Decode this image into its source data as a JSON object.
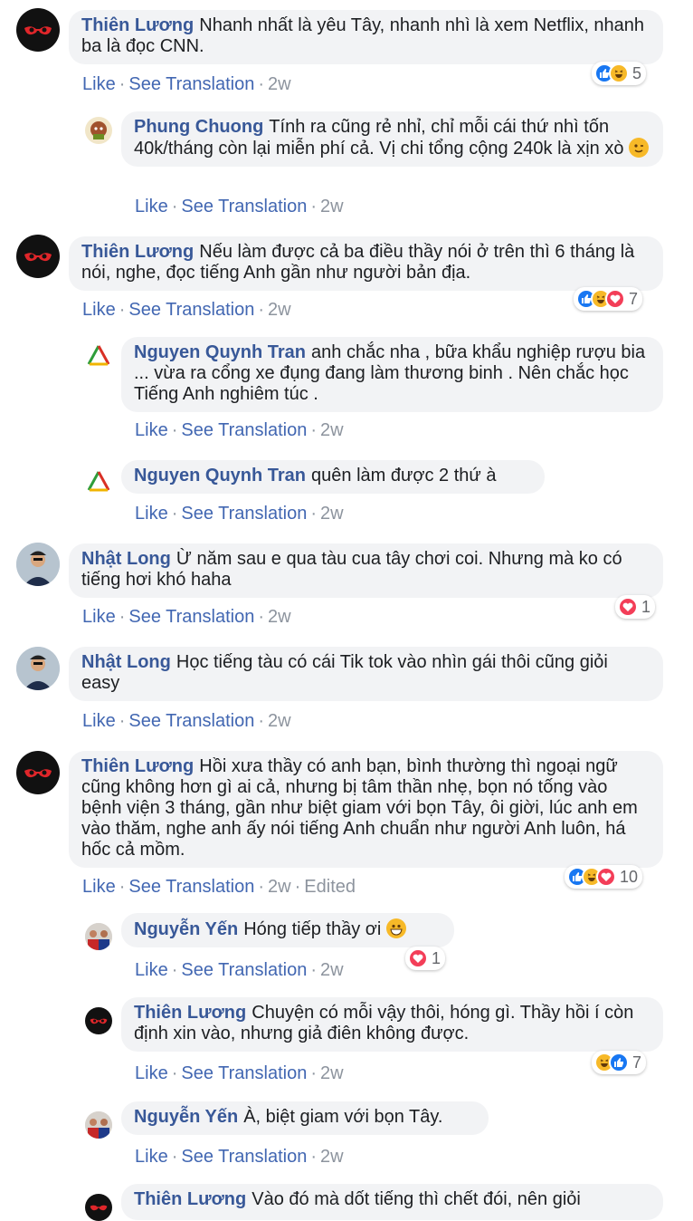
{
  "ui": {
    "like": "Like",
    "see_translation": "See Translation",
    "edited": "Edited",
    "dot": "·"
  },
  "colors": {
    "link": "#385898",
    "action": "#4267b2",
    "meta": "#8d949e",
    "bubble": "#f2f3f5",
    "like": "#1877f2",
    "haha": "#f7b928",
    "love": "#f33e58"
  },
  "comments": [
    {
      "author": "Thiên Lương",
      "text": "Nhanh nhất là yêu Tây, nhanh nhì là xem Netflix, nhanh ba là đọc CNN.",
      "time": "2w",
      "avatar": "red-glasses",
      "reactions": [
        "like",
        "haha"
      ],
      "reaction_count": "5"
    },
    {
      "author": "Phung Chuong",
      "text": "Tính ra cũng rẻ nhỉ, chỉ mỗi cái thứ nhì tốn 40k/tháng còn lại miễn phí cả. Vị chi tổng cộng 240k là xịn xò",
      "emoji": "wink",
      "time": "2w",
      "avatar": "cartoon"
    },
    {
      "author": "Thiên Lương",
      "text": "Nếu làm được cả ba điều thầy nói ở trên thì 6 tháng là nói, nghe, đọc tiếng Anh gần như người bản địa.",
      "time": "2w",
      "avatar": "red-glasses",
      "reactions": [
        "like",
        "haha",
        "love"
      ],
      "reaction_count": "7"
    },
    {
      "author": "Nguyen Quynh Tran",
      "text": "anh chắc nha , bữa khẩu nghiệp rượu bia ... vừa ra cổng xe đụng đang làm thương binh . Nên chắc học Tiếng Anh nghiêm túc .",
      "time": "2w",
      "avatar": "triangle"
    },
    {
      "author": "Nguyen Quynh Tran",
      "text": "quên làm được 2 thứ à",
      "time": "2w",
      "avatar": "triangle"
    },
    {
      "author": "Nhật Long",
      "text": "Ừ năm sau e qua tàu cua tây chơi coi. Nhưng mà ko có tiếng hơi khó haha",
      "time": "2w",
      "avatar": "person",
      "reactions": [
        "love"
      ],
      "reaction_count": "1"
    },
    {
      "author": "Nhật Long",
      "text": "Học tiếng tàu có cái Tik tok vào nhìn gái thôi cũng giỏi easy",
      "time": "2w",
      "avatar": "person"
    },
    {
      "author": "Thiên Lương",
      "text": "Hồi xưa thầy có anh bạn, bình thường thì ngoại ngữ cũng không hơn gì ai cả, nhưng bị tâm thần nhẹ, bọn nó tống vào bệnh viện 3 tháng, gần như biệt giam với bọn Tây, ôi giời, lúc anh em vào thăm, nghe anh ấy nói tiếng Anh chuẩn như người Anh luôn, há hốc cả mồm.",
      "time": "2w",
      "edited": true,
      "avatar": "red-glasses",
      "reactions": [
        "like",
        "haha",
        "love"
      ],
      "reaction_count": "10"
    },
    {
      "author": "Nguyễn Yến",
      "text": "Hóng tiếp thầy ơi",
      "emoji": "grin",
      "time": "2w",
      "avatar": "group",
      "reactions": [
        "love"
      ],
      "reaction_count": "1"
    },
    {
      "author": "Thiên Lương",
      "text": "Chuyện có mỗi vậy thôi, hóng gì. Thầy hồi í còn định xin vào, nhưng giả điên không được.",
      "time": "2w",
      "avatar": "red-glasses",
      "reactions": [
        "haha",
        "like"
      ],
      "reaction_count": "7"
    },
    {
      "author": "Nguyễn Yến",
      "text": "À, biệt giam với bọn Tây.",
      "time": "2w",
      "avatar": "group"
    },
    {
      "author": "Thiên Lương",
      "text": "Vào đó mà dốt tiếng thì chết đói, nên giỏi",
      "time": "",
      "avatar": "red-glasses"
    }
  ]
}
